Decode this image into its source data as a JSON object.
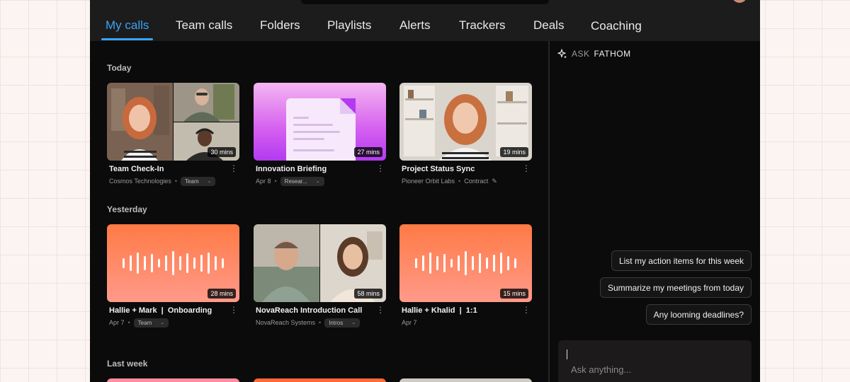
{
  "nav": {
    "tabs": [
      {
        "label": "My calls",
        "active": true
      },
      {
        "label": "Team calls"
      },
      {
        "label": "Folders"
      },
      {
        "label": "Playlists"
      },
      {
        "label": "Alerts"
      },
      {
        "label": "Trackers"
      },
      {
        "label": "Deals"
      },
      {
        "label": "Coaching"
      }
    ]
  },
  "sections": [
    {
      "title": "Today",
      "cards": [
        {
          "title": "Team Check-In",
          "duration": "30 mins",
          "meta": "Cosmos Technologies",
          "tag": "Team",
          "thumb": "video-grid"
        },
        {
          "title": "Innovation Briefing",
          "duration": "27 mins",
          "meta": "Apr 8",
          "tag": "Resear...",
          "thumb": "document"
        },
        {
          "title": "Project Status Sync",
          "duration": "19 mins",
          "meta": "Pioneer Orbit Labs",
          "tag": "Contract",
          "thumb": "video-single"
        }
      ]
    },
    {
      "title": "Yesterday",
      "cards": [
        {
          "title": "Hallie + Mark  |  Onboarding",
          "duration": "28 mins",
          "meta": "Apr 7",
          "tag": "Team",
          "thumb": "waveform"
        },
        {
          "title": "NovaReach Introduction Call",
          "duration": "58 mins",
          "meta": "NovaReach Systems",
          "tag": "Intros",
          "thumb": "video-split"
        },
        {
          "title": "Hallie + Khalid  |  1:1",
          "duration": "15 mins",
          "meta": "Apr 7",
          "thumb": "waveform"
        }
      ]
    },
    {
      "title": "Last week",
      "cards": []
    }
  ],
  "ask": {
    "label_prefix": "ASK",
    "label_brand": "FATHOM",
    "suggestions": [
      "List my action items for this week",
      "Summarize my meetings from today",
      "Any looming deadlines?"
    ],
    "placeholder": "Ask anything..."
  },
  "colors": {
    "accent": "#3aa3f5",
    "wave_top": "#ff7a45",
    "wave_bottom": "#ff9a8a",
    "doc_pink": "#d55ff0"
  }
}
